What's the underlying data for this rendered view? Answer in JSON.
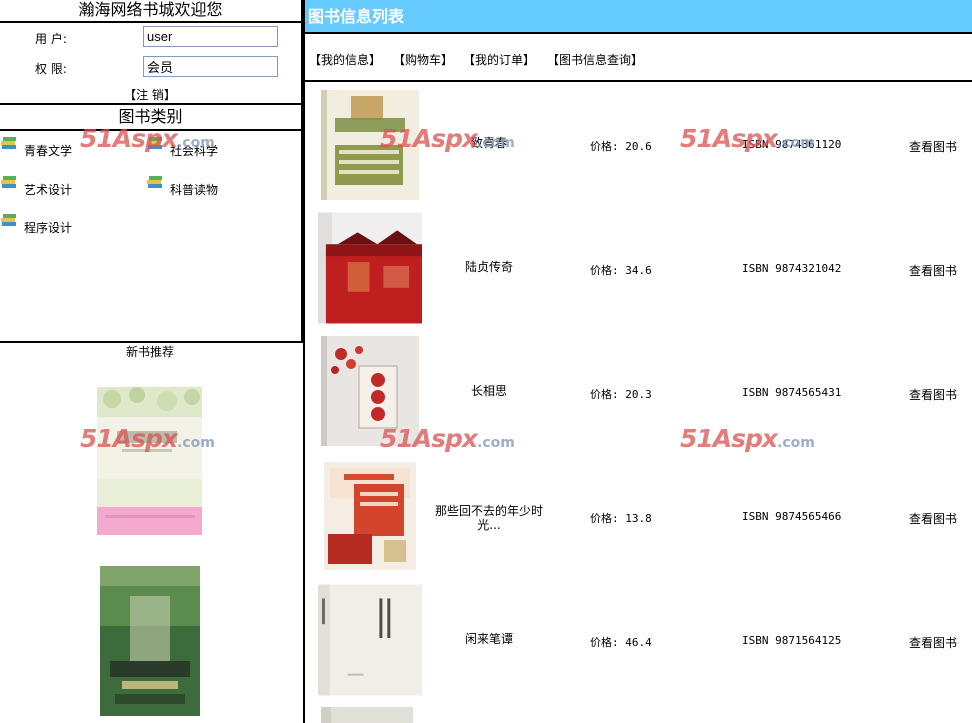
{
  "welcome": "瀚海网络书城欢迎您",
  "user_form": {
    "user_label": "用  户:",
    "user_value": "user",
    "role_label": "权  限:",
    "role_value": "会员",
    "logout": "【注 销】"
  },
  "categories": {
    "title": "图书类别",
    "items": [
      "青春文学",
      "社会科学",
      "艺术设计",
      "科普读物",
      "程序设计"
    ]
  },
  "new_books": {
    "title": "新书推荐"
  },
  "list": {
    "title": "图书信息列表",
    "nav": [
      "【我的信息】",
      "【购物车】",
      "【我的订单】",
      "【图书信息查询】"
    ],
    "books": [
      {
        "title": "致青春",
        "price": "价格: 20.6",
        "isbn": "ISBN 9874361120",
        "action": "查看图书"
      },
      {
        "title": "陆贞传奇",
        "price": "价格: 34.6",
        "isbn": "ISBN 9874321042",
        "action": "查看图书"
      },
      {
        "title": "长相思",
        "price": "价格: 20.3",
        "isbn": "ISBN 9874565431",
        "action": "查看图书"
      },
      {
        "title": "那些回不去的年少时光...",
        "price": "价格: 13.8",
        "isbn": "ISBN 9874565466",
        "action": "查看图书"
      },
      {
        "title": "闲来笔谭",
        "price": "价格: 46.4",
        "isbn": "ISBN 9871564125",
        "action": "查看图书"
      }
    ]
  },
  "watermark": {
    "main": "51Aspx",
    "suffix": ".com"
  }
}
